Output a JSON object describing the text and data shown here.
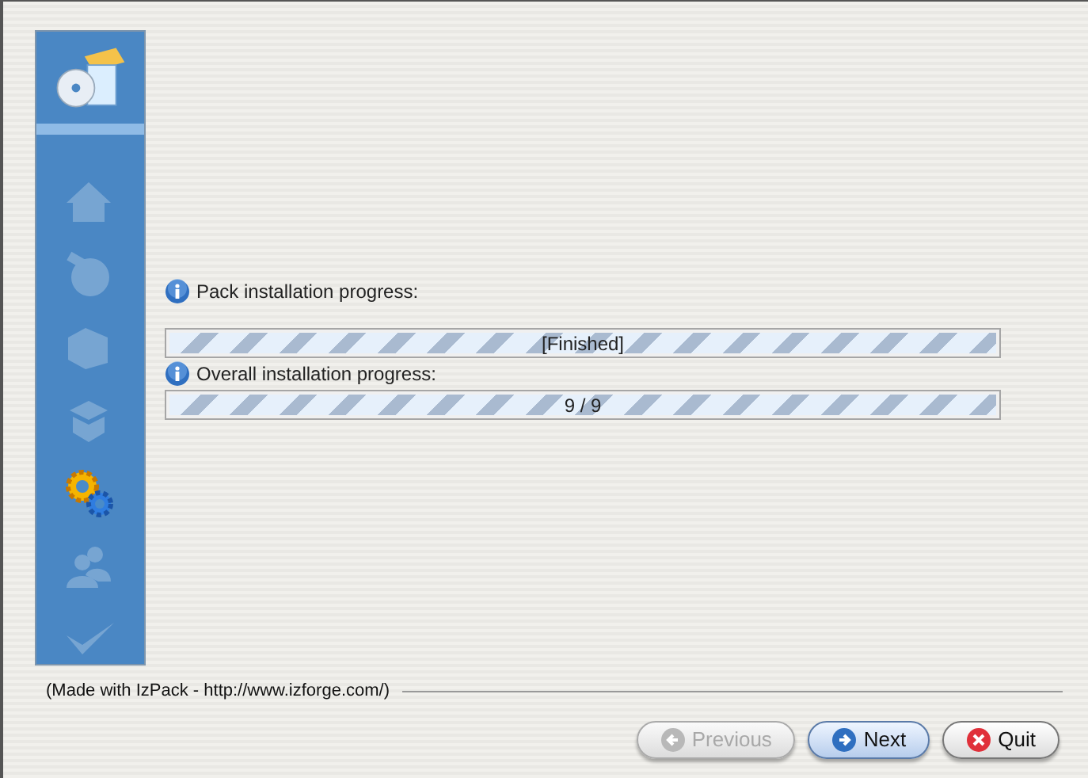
{
  "sidebar": {
    "steps": [
      {
        "kind": "home",
        "selected": false
      },
      {
        "kind": "globe",
        "selected": false
      },
      {
        "kind": "folder",
        "selected": false
      },
      {
        "kind": "box",
        "selected": false
      },
      {
        "kind": "gears",
        "selected": true
      },
      {
        "kind": "users",
        "selected": false
      },
      {
        "kind": "check",
        "selected": false
      }
    ]
  },
  "progress": [
    {
      "label": "Pack installation progress:",
      "bar_text": "[Finished]",
      "level": 1
    },
    {
      "label": "Overall installation progress:",
      "bar_text": "9 / 9",
      "level": 1
    }
  ],
  "footer": {
    "credit": "(Made with IzPack - http://www.izforge.com/)"
  },
  "buttons": [
    {
      "label": "Previous",
      "kind": "previous",
      "disabled": true
    },
    {
      "label": "Next",
      "kind": "next",
      "disabled": false
    },
    {
      "label": "Quit",
      "kind": "quit",
      "disabled": false
    }
  ]
}
